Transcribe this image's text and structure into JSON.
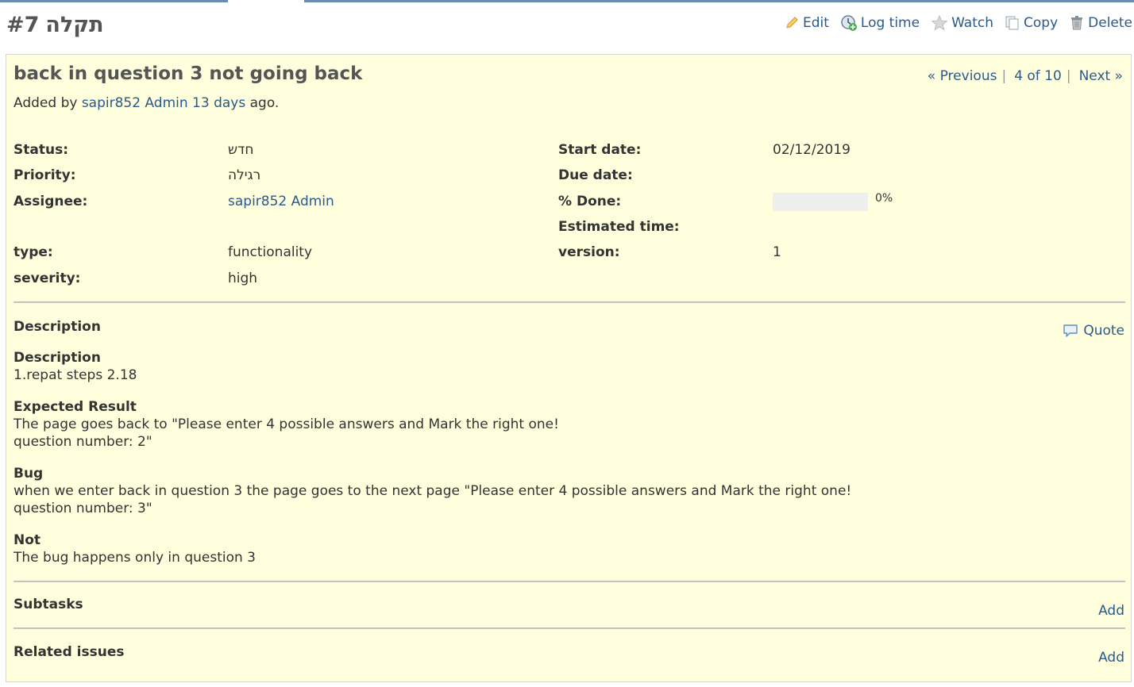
{
  "header": {
    "tracker": "תקלה",
    "issue_number": "#7"
  },
  "actions": {
    "edit": "Edit",
    "log_time": "Log time",
    "watch": "Watch",
    "copy": "Copy",
    "delete": "Delete"
  },
  "issue": {
    "subject": "back in question 3 not going back",
    "added_by_prefix": "Added by",
    "author": "sapir852 Admin",
    "age": "13 days",
    "ago": "ago."
  },
  "pager": {
    "previous": "« Previous",
    "sep": "|",
    "position": "4 of 10",
    "next": "Next »"
  },
  "attributes": {
    "status_label": "Status:",
    "status": "חדש",
    "priority_label": "Priority:",
    "priority": "רגילה",
    "assignee_label": "Assignee:",
    "assignee": "sapir852 Admin",
    "type_label": "type:",
    "type": "functionality",
    "severity_label": "severity:",
    "severity": "high",
    "start_date_label": "Start date:",
    "start_date": "02/12/2019",
    "due_date_label": "Due date:",
    "done_label": "% Done:",
    "done_percent": 0,
    "done_text": "0%",
    "estimated_label": "Estimated time:",
    "version_label": "version:",
    "version": "1"
  },
  "description": {
    "heading": "Description",
    "quote": "Quote",
    "blocks": [
      {
        "heading": "Description",
        "text": "1.repat steps 2.18"
      },
      {
        "heading": "Expected Result",
        "text": "The page goes back to \"Please enter 4 possible answers and Mark the right one!\nquestion number: 2\""
      },
      {
        "heading": "Bug",
        "text": "when we enter back in question 3 the page goes to the next page \"Please enter 4 possible answers and Mark the right one!\nquestion number: 3\""
      },
      {
        "heading": "Not",
        "text": "The bug happens only in question 3"
      }
    ]
  },
  "subtasks": {
    "heading": "Subtasks",
    "add": "Add"
  },
  "related": {
    "heading": "Related issues",
    "add": "Add"
  }
}
